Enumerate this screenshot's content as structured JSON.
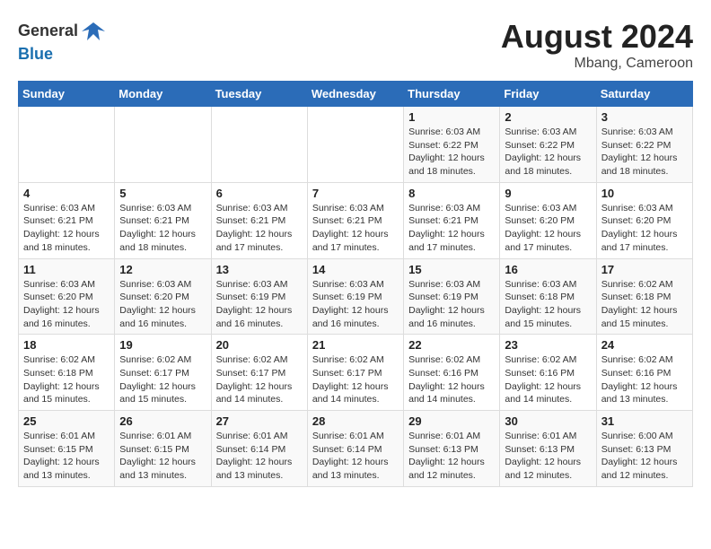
{
  "header": {
    "logo_line1": "General",
    "logo_line2": "Blue",
    "month_year": "August 2024",
    "location": "Mbang, Cameroon"
  },
  "weekdays": [
    "Sunday",
    "Monday",
    "Tuesday",
    "Wednesday",
    "Thursday",
    "Friday",
    "Saturday"
  ],
  "weeks": [
    [
      {
        "day": "",
        "info": ""
      },
      {
        "day": "",
        "info": ""
      },
      {
        "day": "",
        "info": ""
      },
      {
        "day": "",
        "info": ""
      },
      {
        "day": "1",
        "info": "Sunrise: 6:03 AM\nSunset: 6:22 PM\nDaylight: 12 hours\nand 18 minutes."
      },
      {
        "day": "2",
        "info": "Sunrise: 6:03 AM\nSunset: 6:22 PM\nDaylight: 12 hours\nand 18 minutes."
      },
      {
        "day": "3",
        "info": "Sunrise: 6:03 AM\nSunset: 6:22 PM\nDaylight: 12 hours\nand 18 minutes."
      }
    ],
    [
      {
        "day": "4",
        "info": "Sunrise: 6:03 AM\nSunset: 6:21 PM\nDaylight: 12 hours\nand 18 minutes."
      },
      {
        "day": "5",
        "info": "Sunrise: 6:03 AM\nSunset: 6:21 PM\nDaylight: 12 hours\nand 18 minutes."
      },
      {
        "day": "6",
        "info": "Sunrise: 6:03 AM\nSunset: 6:21 PM\nDaylight: 12 hours\nand 17 minutes."
      },
      {
        "day": "7",
        "info": "Sunrise: 6:03 AM\nSunset: 6:21 PM\nDaylight: 12 hours\nand 17 minutes."
      },
      {
        "day": "8",
        "info": "Sunrise: 6:03 AM\nSunset: 6:21 PM\nDaylight: 12 hours\nand 17 minutes."
      },
      {
        "day": "9",
        "info": "Sunrise: 6:03 AM\nSunset: 6:20 PM\nDaylight: 12 hours\nand 17 minutes."
      },
      {
        "day": "10",
        "info": "Sunrise: 6:03 AM\nSunset: 6:20 PM\nDaylight: 12 hours\nand 17 minutes."
      }
    ],
    [
      {
        "day": "11",
        "info": "Sunrise: 6:03 AM\nSunset: 6:20 PM\nDaylight: 12 hours\nand 16 minutes."
      },
      {
        "day": "12",
        "info": "Sunrise: 6:03 AM\nSunset: 6:20 PM\nDaylight: 12 hours\nand 16 minutes."
      },
      {
        "day": "13",
        "info": "Sunrise: 6:03 AM\nSunset: 6:19 PM\nDaylight: 12 hours\nand 16 minutes."
      },
      {
        "day": "14",
        "info": "Sunrise: 6:03 AM\nSunset: 6:19 PM\nDaylight: 12 hours\nand 16 minutes."
      },
      {
        "day": "15",
        "info": "Sunrise: 6:03 AM\nSunset: 6:19 PM\nDaylight: 12 hours\nand 16 minutes."
      },
      {
        "day": "16",
        "info": "Sunrise: 6:03 AM\nSunset: 6:18 PM\nDaylight: 12 hours\nand 15 minutes."
      },
      {
        "day": "17",
        "info": "Sunrise: 6:02 AM\nSunset: 6:18 PM\nDaylight: 12 hours\nand 15 minutes."
      }
    ],
    [
      {
        "day": "18",
        "info": "Sunrise: 6:02 AM\nSunset: 6:18 PM\nDaylight: 12 hours\nand 15 minutes."
      },
      {
        "day": "19",
        "info": "Sunrise: 6:02 AM\nSunset: 6:17 PM\nDaylight: 12 hours\nand 15 minutes."
      },
      {
        "day": "20",
        "info": "Sunrise: 6:02 AM\nSunset: 6:17 PM\nDaylight: 12 hours\nand 14 minutes."
      },
      {
        "day": "21",
        "info": "Sunrise: 6:02 AM\nSunset: 6:17 PM\nDaylight: 12 hours\nand 14 minutes."
      },
      {
        "day": "22",
        "info": "Sunrise: 6:02 AM\nSunset: 6:16 PM\nDaylight: 12 hours\nand 14 minutes."
      },
      {
        "day": "23",
        "info": "Sunrise: 6:02 AM\nSunset: 6:16 PM\nDaylight: 12 hours\nand 14 minutes."
      },
      {
        "day": "24",
        "info": "Sunrise: 6:02 AM\nSunset: 6:16 PM\nDaylight: 12 hours\nand 13 minutes."
      }
    ],
    [
      {
        "day": "25",
        "info": "Sunrise: 6:01 AM\nSunset: 6:15 PM\nDaylight: 12 hours\nand 13 minutes."
      },
      {
        "day": "26",
        "info": "Sunrise: 6:01 AM\nSunset: 6:15 PM\nDaylight: 12 hours\nand 13 minutes."
      },
      {
        "day": "27",
        "info": "Sunrise: 6:01 AM\nSunset: 6:14 PM\nDaylight: 12 hours\nand 13 minutes."
      },
      {
        "day": "28",
        "info": "Sunrise: 6:01 AM\nSunset: 6:14 PM\nDaylight: 12 hours\nand 13 minutes."
      },
      {
        "day": "29",
        "info": "Sunrise: 6:01 AM\nSunset: 6:13 PM\nDaylight: 12 hours\nand 12 minutes."
      },
      {
        "day": "30",
        "info": "Sunrise: 6:01 AM\nSunset: 6:13 PM\nDaylight: 12 hours\nand 12 minutes."
      },
      {
        "day": "31",
        "info": "Sunrise: 6:00 AM\nSunset: 6:13 PM\nDaylight: 12 hours\nand 12 minutes."
      }
    ]
  ]
}
